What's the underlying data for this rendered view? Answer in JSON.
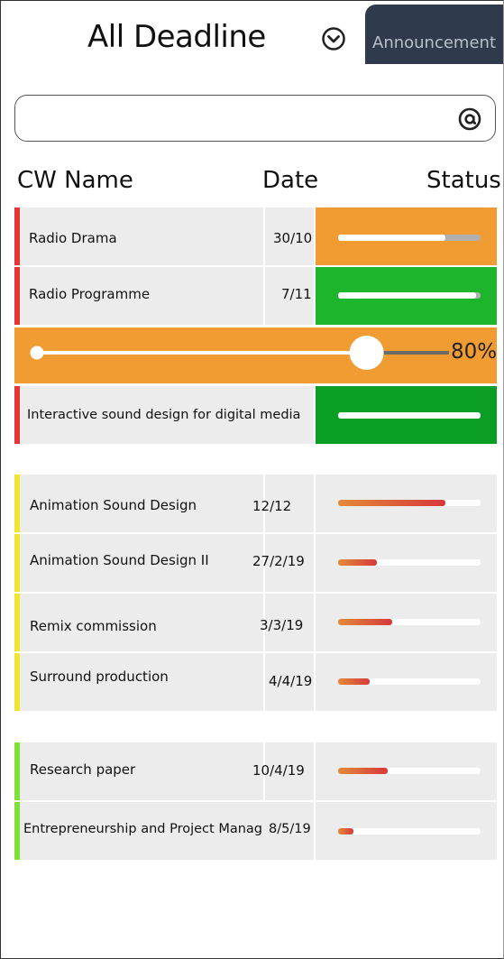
{
  "header": {
    "title": "All Deadline",
    "announcement_tab": "Announcement"
  },
  "search": {
    "value": "",
    "placeholder": ""
  },
  "columns": {
    "name": "CW Name",
    "date": "Date",
    "status": "Status"
  },
  "colors": {
    "urgent": "#e53535",
    "upcoming": "#f0e632",
    "later": "#7fe03a",
    "status_orange": "#f09c33",
    "status_green_light": "#1db52b",
    "status_green_dark": "#0a9e24",
    "tab_bg": "#2f3b4d"
  },
  "coursework": [
    {
      "name": "Radio Drama",
      "date": "30/10",
      "progress": 0.75,
      "group": "urgent",
      "status_color": "orange"
    },
    {
      "name": "Radio Programme",
      "date": "7/11",
      "progress": 0.97,
      "group": "urgent",
      "status_color": "green"
    },
    {
      "name": "Interactive sound design for digital media",
      "date": "",
      "progress": 1.0,
      "group": "urgent",
      "status_color": "green-dark"
    },
    {
      "name": "Animation Sound Design",
      "date": "12/12",
      "progress": 0.75,
      "group": "upcoming"
    },
    {
      "name": "Animation Sound Design II",
      "date": "27/2/19",
      "progress": 0.27,
      "group": "upcoming"
    },
    {
      "name": "Remix commission",
      "date": "3/3/19",
      "progress": 0.38,
      "group": "upcoming"
    },
    {
      "name": "Surround production",
      "date": "4/4/19",
      "progress": 0.22,
      "group": "upcoming"
    },
    {
      "name": "Research paper",
      "date": "10/4/19",
      "progress": 0.35,
      "group": "later"
    },
    {
      "name": "Entrepreneurship and Project Manag",
      "date": "8/5/19",
      "progress": 0.11,
      "group": "later"
    }
  ],
  "progress_slider": {
    "value": 0.8,
    "label": "80%"
  }
}
